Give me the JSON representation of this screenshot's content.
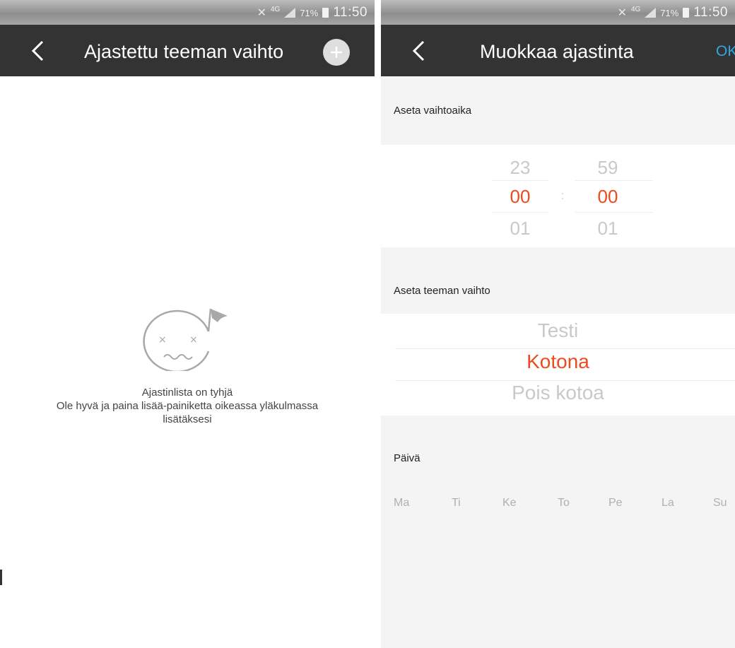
{
  "status_bar": {
    "network": "4G",
    "battery_percent": "71%",
    "time": "11:50"
  },
  "left_screen": {
    "title": "Ajastettu teeman vaihto",
    "empty_title": "Ajastinlista on tyhjä",
    "empty_line2": "Ole hyvä ja paina lisää-painiketta oikeassa yläkulmassa",
    "empty_line3": "lisätäksesi",
    "icons": {
      "back": "chevron-left-icon",
      "add": "plus-icon",
      "empty": "sad-face-flag-icon"
    }
  },
  "right_screen": {
    "title": "Muokkaa ajastinta",
    "ok_label": "OK",
    "time_section_label": "Aseta vaihtoaika",
    "hours": {
      "prev": "23",
      "selected": "00",
      "next": "01"
    },
    "minutes": {
      "prev": "59",
      "selected": "00",
      "next": "01"
    },
    "separator": ":",
    "theme_section_label": "Aseta teeman vaihto",
    "themes": {
      "prev": "Testi",
      "selected": "Kotona",
      "next": "Pois kotoa"
    },
    "day_section_label": "Päivä",
    "days": [
      "Ma",
      "Ti",
      "Ke",
      "To",
      "Pe",
      "La",
      "Su"
    ]
  },
  "colors": {
    "accent_orange": "#ee4a1e",
    "ok_blue": "#2fa8e0",
    "app_bar": "#333333"
  }
}
